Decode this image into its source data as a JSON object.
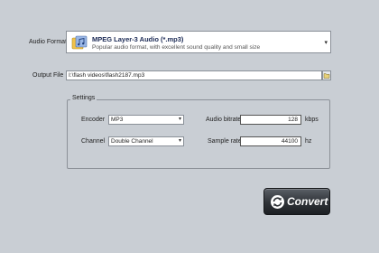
{
  "audio_format": {
    "label": "Audio Format",
    "selected_title": "MPEG Layer-3 Audio (*.mp3)",
    "selected_desc": "Popular audio format, with excellent sound quality and small size",
    "icon": "music-file-icon"
  },
  "output_file": {
    "label": "Output File",
    "value": "I:\\flash videos\\flash2187.mp3"
  },
  "settings": {
    "legend": "Settings",
    "encoder_label": "Encoder",
    "encoder_value": "MP3",
    "channel_label": "Channel",
    "channel_value": "Double Channel",
    "bitrate_label": "Audio bitrate",
    "bitrate_value": "128",
    "bitrate_unit": "kbps",
    "samplerate_label": "Sample rate",
    "samplerate_value": "44100",
    "samplerate_unit": "hz"
  },
  "convert": {
    "label": "Convert"
  }
}
